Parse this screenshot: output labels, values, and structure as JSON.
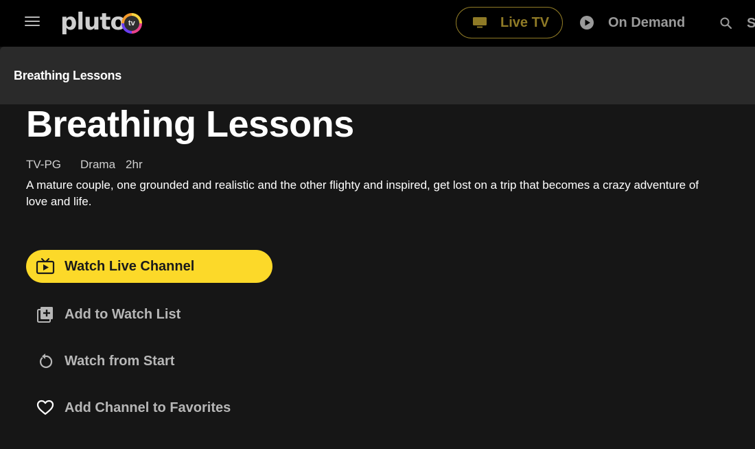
{
  "header": {
    "brand": "pluto",
    "brand_badge": "tv",
    "nav": {
      "live_tv": "Live TV",
      "on_demand": "On Demand",
      "search_partial": "S"
    }
  },
  "titlebar": {
    "title": "Breathing Lessons"
  },
  "program": {
    "title": "Breathing Lessons",
    "rating": "TV-PG",
    "genre": "Drama",
    "duration": "2hr",
    "description_line1": "A mature couple, one grounded and realistic and the other flighty and inspired, get lost on a trip that becomes a crazy adventure of",
    "description_line2": "love and life."
  },
  "actions": {
    "watch_live": "Watch Live Channel",
    "add_watch_list": "Add to Watch List",
    "watch_from_start": "Watch from Start",
    "add_favorites": "Add Channel to Favorites"
  },
  "colors": {
    "accent": "#fcd929",
    "background": "#161616",
    "topbar": "#000000",
    "titlebar": "#2a2a2a"
  }
}
